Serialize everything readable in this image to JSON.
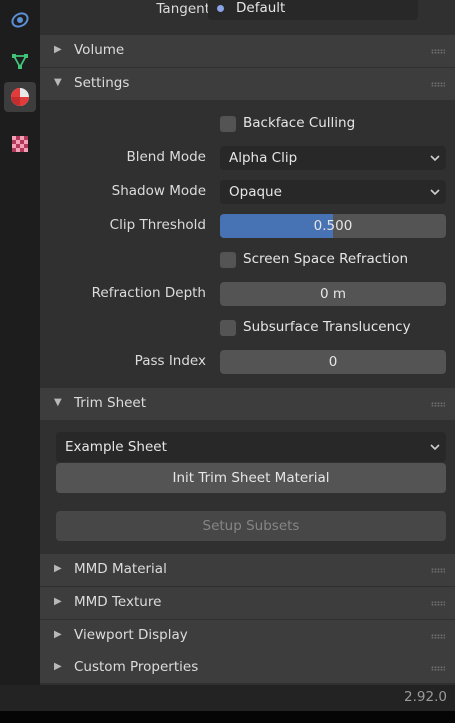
{
  "properties": {
    "tangent": {
      "label": "Tangent",
      "value": "Default"
    },
    "panels": {
      "volume": "Volume",
      "settings": "Settings",
      "trim_sheet": "Trim Sheet",
      "mmd_material": "MMD Material",
      "mmd_texture": "MMD Texture",
      "viewport_display": "Viewport Display",
      "custom_properties": "Custom Properties"
    },
    "settings": {
      "backface_culling": {
        "label": "Backface Culling",
        "checked": false
      },
      "blend_mode": {
        "label": "Blend Mode",
        "value": "Alpha Clip"
      },
      "shadow_mode": {
        "label": "Shadow Mode",
        "value": "Opaque"
      },
      "clip_threshold": {
        "label": "Clip Threshold",
        "value": "0.500",
        "fraction": 0.5
      },
      "screen_space_refraction": {
        "label": "Screen Space Refraction",
        "checked": false
      },
      "refraction_depth": {
        "label": "Refraction Depth",
        "value": "0 m"
      },
      "subsurface_translucency": {
        "label": "Subsurface Translucency",
        "checked": false
      },
      "pass_index": {
        "label": "Pass Index",
        "value": "0"
      }
    },
    "trim_sheet": {
      "selected": "Example Sheet",
      "init_button": "Init Trim Sheet Material",
      "setup_button": "Setup Subsets"
    }
  },
  "status_bar": {
    "version": "2.92.0"
  },
  "sidebar": {
    "tabs": [
      {
        "icon": "object-data-icon"
      },
      {
        "icon": "vertex-group-icon"
      },
      {
        "icon": "material-icon",
        "active": true
      },
      {
        "icon": "texture-checker-icon"
      }
    ]
  },
  "colors": {
    "accent": "#4772b3",
    "background": "#303030",
    "header": "#3d3d3d",
    "field": "#545454",
    "dropdown": "#282828"
  }
}
